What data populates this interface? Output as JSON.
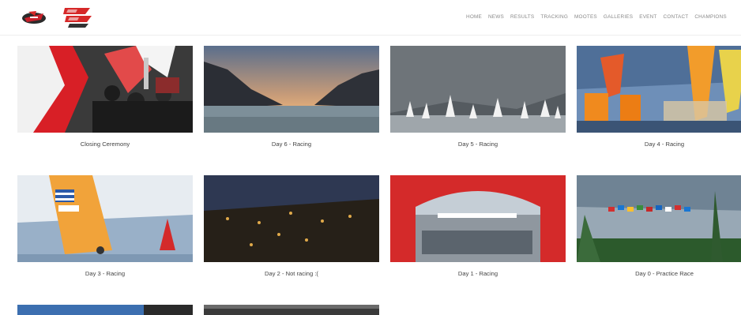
{
  "header": {
    "logos": [
      {
        "name": "fleet-logo-small",
        "colors": [
          "#c8202a",
          "#222222"
        ]
      },
      {
        "name": "event-logo-red",
        "colors": [
          "#d62828",
          "#222222"
        ]
      }
    ],
    "nav": [
      "HOME",
      "NEWS",
      "RESULTS",
      "TRACKING",
      "MOOTES",
      "GALLERIES",
      "EVENT",
      "CONTACT",
      "CHAMPIONS"
    ]
  },
  "gallery": {
    "items": [
      {
        "caption": "Closing Ceremony"
      },
      {
        "caption": "Day 6 - Racing"
      },
      {
        "caption": "Day 5 - Racing"
      },
      {
        "caption": "Day 4 - Racing"
      },
      {
        "caption": "Day 3 - Racing"
      },
      {
        "caption": "Day 2 - Not racing :("
      },
      {
        "caption": "Day 1 - Racing"
      },
      {
        "caption": "Day 0 - Practice Race"
      }
    ]
  },
  "colors": {
    "accent_red": "#d81f26",
    "nav_text": "#8a8a8a",
    "caption_text": "#444444"
  }
}
